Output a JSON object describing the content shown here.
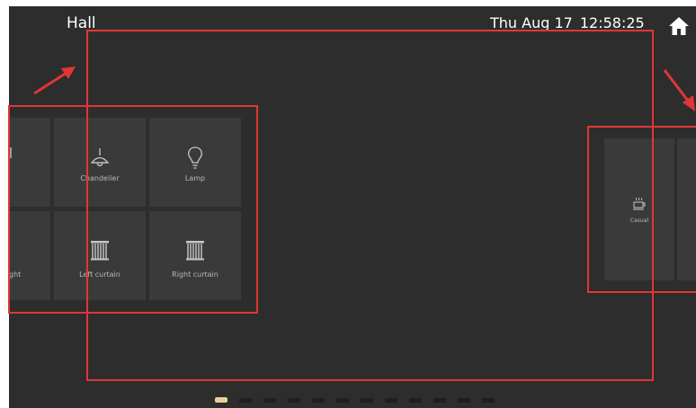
{
  "header": {
    "room_title": "Hall",
    "date": "Thu Aug 17",
    "time": "12:58:25",
    "home_icon": "home-icon"
  },
  "devices": {
    "left_partial_label": "ght",
    "chandelier_label": "Chandelier",
    "lamp_label": "Lamp",
    "left_curtain_label": "Left curtain",
    "right_curtain_label": "Right curtain"
  },
  "scenes": {
    "casual_label": "Casual"
  },
  "pager": {
    "pages": 12,
    "active_page": 1
  },
  "colors": {
    "background": "#2d2d2d",
    "tile": "#3a3a3a",
    "annotation": "#e23535",
    "pager_active": "#e9d29a"
  }
}
